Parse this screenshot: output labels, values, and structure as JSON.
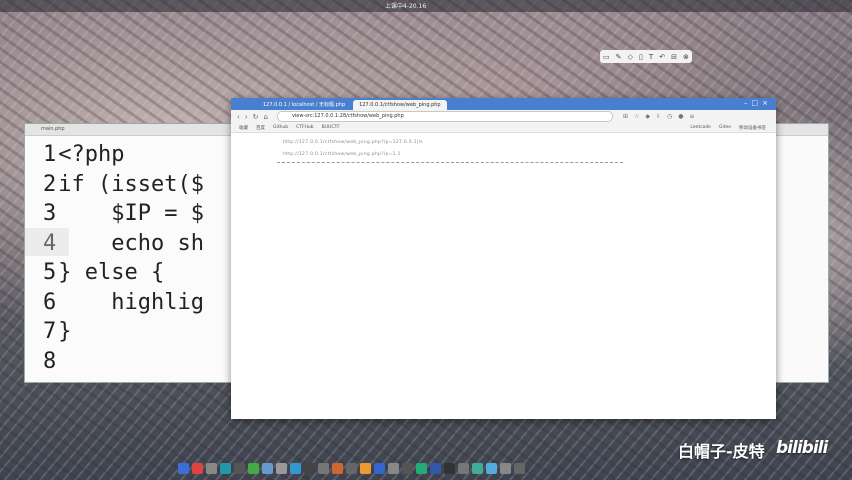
{
  "topbar": {
    "title": "上课中4-20.16"
  },
  "editor": {
    "tab_label": "main.php",
    "lines": [
      {
        "n": "1",
        "text": "<?php"
      },
      {
        "n": "2",
        "text": "if (isset($"
      },
      {
        "n": "3",
        "text": "    $IP = $"
      },
      {
        "n": "4",
        "text": "    echo sh"
      },
      {
        "n": "5",
        "text": "} else {"
      },
      {
        "n": "6",
        "text": "    highlig"
      },
      {
        "n": "7",
        "text": "}"
      },
      {
        "n": "8",
        "text": ""
      }
    ]
  },
  "browser": {
    "tabs": [
      {
        "label": "127.0.0.1 / localhost / 无标题.php"
      },
      {
        "label": "127.0.0.1/ctfshow/web_ping.php"
      }
    ],
    "url": "view-src:127.0.0.1:28/ctfshow/web_ping.php",
    "bookmarks": [
      "收藏",
      "百度",
      "Github",
      "CTFHub",
      "BUUCTF"
    ],
    "bookmarks_right": [
      "Leetcode",
      "Gitee",
      "移动设备书签"
    ],
    "content_lines": [
      "http://127.0.0.1/ctfshow/web_ping.php?ip=127.0.0.1|ls",
      "http://127.0.0.1/ctfshow/web_ping.php?ip=1.1"
    ]
  },
  "watermark": {
    "author": "白帽子-皮特",
    "site": "bilibili"
  },
  "colors": {
    "browser_tab_bar": "#4a7fd0",
    "editor_bg": "#fbfbfb"
  }
}
